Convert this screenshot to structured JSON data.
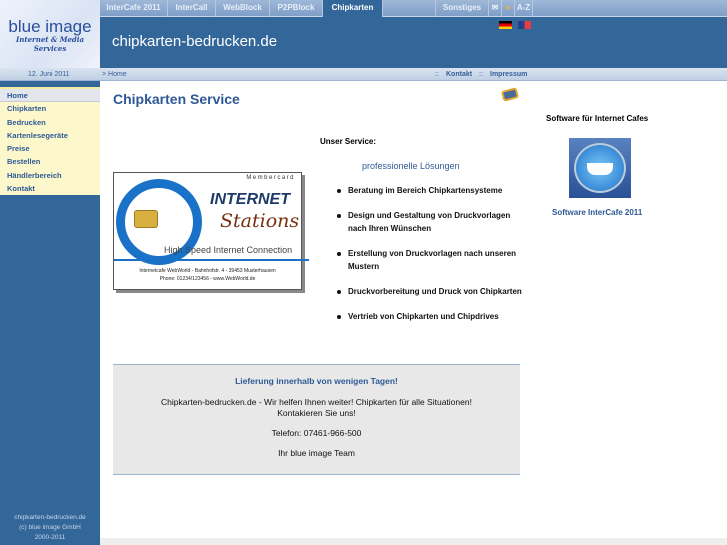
{
  "logo": {
    "line1": "blue image",
    "line2": "Internet & Media Services"
  },
  "nav": {
    "tabs": [
      {
        "label": "InterCafe 2011"
      },
      {
        "label": "InterCall"
      },
      {
        "label": "WebBlock"
      },
      {
        "label": "P2PBlock"
      },
      {
        "label": "Chipkarten",
        "active": true
      },
      {
        "label": ""
      },
      {
        "label": "Sonstiges"
      },
      {
        "label": "A-Z"
      }
    ]
  },
  "header": {
    "title": "chipkarten-bedrucken.de"
  },
  "datebar": {
    "date": "12. Juni 2011",
    "breadcrumb": "> Home",
    "sep": "::",
    "kontakt": "Kontakt",
    "impressum": "Impressum"
  },
  "sidebar": {
    "items": [
      "Home",
      "Chipkarten",
      "Bedrucken",
      "Kartenlesegeräte",
      "Preise",
      "Bestellen",
      "Händlerbereich",
      "Kontakt"
    ],
    "footer": [
      "chipkarten-bedrucken.de",
      "(c) blue image GmbH",
      "2000-2011"
    ]
  },
  "main": {
    "title": "Chipkarten Service",
    "service_heading": "Unser Service:",
    "service_sub": "professionelle Lösungen",
    "services": [
      "Beratung im Bereich Chipkartensysteme",
      "Design und Gestaltung von Druckvorlagen nach Ihren Wünschen",
      "Erstellung von Druckvorlagen nach unseren Mustern",
      "Druckvorbereitung und Druck von Chipkarten",
      "Vertrieb von Chipkarten und Chipdrives"
    ],
    "card": {
      "label": "Membercard",
      "brand1": "INTERNET",
      "brand2": "Stations",
      "tagline": "High Speed Internet Connection",
      "addr1": "Internetcafe WebWorld - Bahnhofstr. 4 - 39453 Musterhausen",
      "addr2": "Phone: 01234/123456 - www.WebWorld.de"
    },
    "box": {
      "heading": "Lieferung innerhalb von wenigen Tagen!",
      "line1": "Chipkarten-bedrucken.de - Wir helfen Ihnen weiter! Chipkarten für alle Situationen!",
      "line2": "Kontakieren Sie uns!",
      "phone": "Telefon: 07461-966-500",
      "sign": "Ihr blue image Team"
    }
  },
  "right": {
    "heading": "Software für Internet Cafes",
    "link": "Software InterCafe 2011"
  }
}
